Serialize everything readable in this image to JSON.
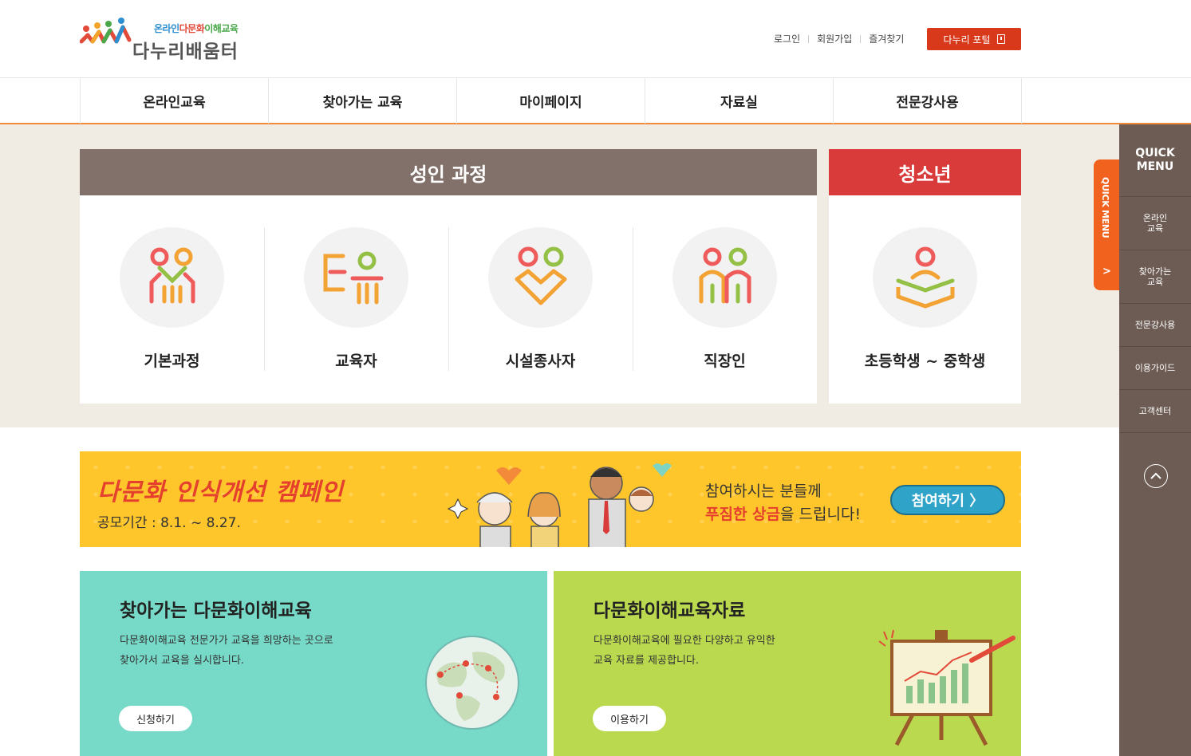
{
  "header": {
    "logo_sub_1": "온라인",
    "logo_sub_2": "다문화",
    "logo_sub_3": "이해교육",
    "logo_main": "다누리배움터",
    "util_links": [
      "로그인",
      "회원가입",
      "즐겨찾기"
    ],
    "portal_label": "다누리 포털"
  },
  "nav": {
    "items": [
      "온라인교육",
      "찾아가는 교육",
      "마이페이지",
      "자료실",
      "전문강사용"
    ]
  },
  "courses": {
    "adult_title": "성인 과정",
    "adult_items": [
      "기본과정",
      "교육자",
      "시설종사자",
      "직장인"
    ],
    "youth_title": "청소년",
    "youth_items": [
      "초등학생 ~ 중학생"
    ]
  },
  "campaign": {
    "title": "다문화 인식개선 캠페인",
    "period": "공모기간 : 8.1. ~ 8.27.",
    "message_line1": "참여하시는 분들께",
    "message_highlight": "푸짐한 상금",
    "message_rest": "을 드립니다!",
    "button_label": "참여하기 〉"
  },
  "promos": {
    "visit": {
      "title": "찾아가는 다문화이해교육",
      "desc_line1": "다문화이해교육 전문가가 교육을 희망하는 곳으로",
      "desc_line2": "찾아가서 교육을 실시합니다.",
      "button": "신청하기"
    },
    "data": {
      "title": "다문화이해교육자료",
      "desc_line1": "다문화이해교육에 필요한 다양하고 유익한",
      "desc_line2": "교육 자료를 제공합니다.",
      "button": "이용하기"
    }
  },
  "quick_menu": {
    "tab_label": "QUICK MENU",
    "title_line1": "QUICK",
    "title_line2": "MENU",
    "items": [
      {
        "line1": "온라인",
        "line2": "교육"
      },
      {
        "line1": "찾아가는",
        "line2": "교육"
      },
      {
        "line1": "전문강사용",
        "line2": ""
      },
      {
        "line1": "이용가이드",
        "line2": ""
      },
      {
        "line1": "고객센터",
        "line2": ""
      }
    ]
  },
  "colors": {
    "accent_orange": "#d9391b",
    "adult_header": "#82716a",
    "youth_header": "#d93a3a",
    "campaign_bg": "#ffc62b",
    "promo_visit_bg": "#77d9c7",
    "promo_data_bg": "#bad94f",
    "quick_bg": "#6d5c54"
  },
  "icons": [
    "logo-people-icon",
    "bookmark-icon",
    "course-basic-icon",
    "course-educator-icon",
    "course-facility-icon",
    "course-worker-icon",
    "course-youth-icon",
    "globe-map-icon",
    "easel-chart-icon",
    "chevron-right-icon",
    "chevron-up-icon"
  ]
}
